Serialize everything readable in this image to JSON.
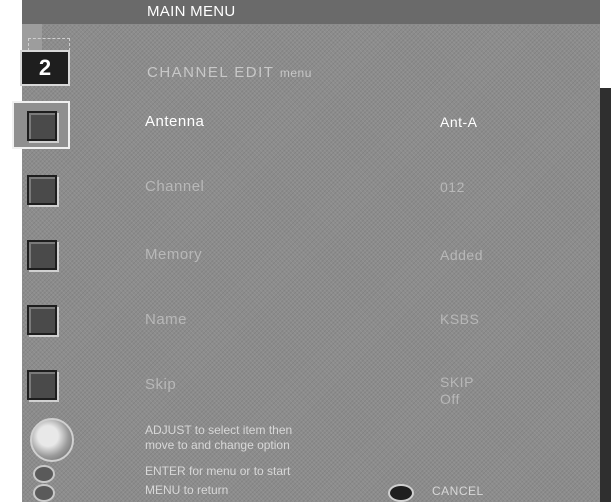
{
  "header": {
    "title": "MAIN MENU"
  },
  "channel": {
    "number": "2"
  },
  "heading": {
    "main": "CHANNEL EDIT",
    "suffix": "menu"
  },
  "items": [
    {
      "label": "Antenna",
      "value": "Ant-A",
      "selected": true
    },
    {
      "label": "Channel",
      "value": "012",
      "selected": false
    },
    {
      "label": "Memory",
      "value": "Added",
      "selected": false
    },
    {
      "label": "Name",
      "value": "KSBS",
      "selected": false
    },
    {
      "label": "Skip",
      "value": "SKIP",
      "value2": "Off",
      "selected": false
    }
  ],
  "help": {
    "adjust_line1": "ADJUST to select item then",
    "adjust_line2": "move to and change option",
    "enter_line": "ENTER for menu or to start",
    "menu_line": "MENU to return",
    "cancel_label": "CANCEL"
  },
  "colors": {
    "screen": "#8c8c8c",
    "active_text": "#ffffff",
    "inactive_text": "#b8b8b8"
  },
  "icons": {
    "item": "square-button-icon",
    "dial": "adjust-dial-icon",
    "enter": "enter-button-icon",
    "menu": "menu-button-icon",
    "cancel": "cancel-button-icon"
  }
}
